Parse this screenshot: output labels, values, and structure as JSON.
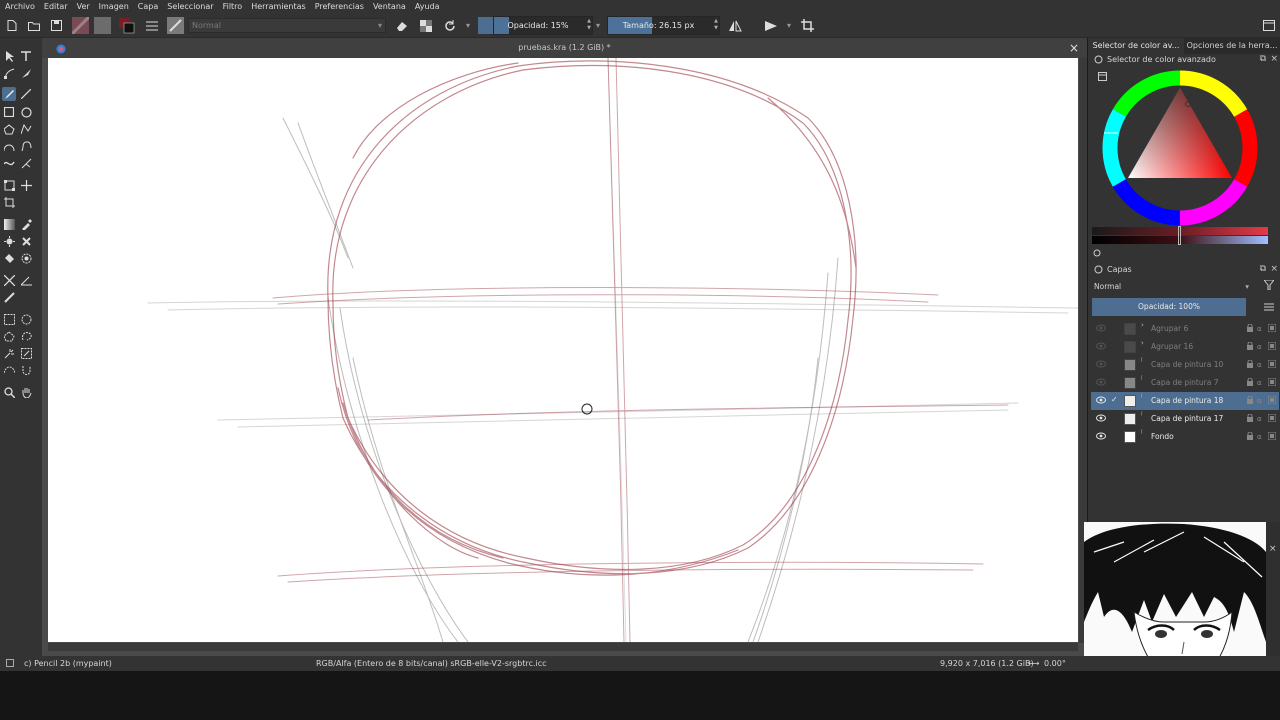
{
  "menu": [
    "Archivo",
    "Editar",
    "Ver",
    "Imagen",
    "Capa",
    "Seleccionar",
    "Filtro",
    "Herramientas",
    "Preferencias",
    "Ventana",
    "Ayuda"
  ],
  "toolbar": {
    "blend_mode": "Normal",
    "opacity_label": "Opacidad: 15%",
    "opacity_fraction": 0.15,
    "size_label": "Tamaño: 26.15 px",
    "size_fraction": 0.4
  },
  "document": {
    "title": "pruebas.kra (1.2 GiB) *",
    "close_glyph": "×"
  },
  "status": {
    "brush": "c) Pencil 2b (mypaint)",
    "color_space": "RGB/Alfa (Entero de 8 bits/canal)  sRGB-elle-V2-srgbtrc.icc",
    "dimensions": "9,920 x 7,016 (1.2 GiB)",
    "rotation": "0.00°"
  },
  "dock": {
    "tab1": "Selector de color av...",
    "tab2": "Opciones de la herra...",
    "color_panel_title": "Selector de color avanzado",
    "layers_title": "Capas",
    "layers_blend": "Normal",
    "layers_opacity": "Opacidad:  100%",
    "layers": [
      {
        "name": "Agrupar 6",
        "visible": false,
        "selected": false,
        "group": true
      },
      {
        "name": "Agrupar 16",
        "visible": false,
        "selected": false,
        "group": true
      },
      {
        "name": "Capa de pintura 10",
        "visible": false,
        "selected": false,
        "group": false
      },
      {
        "name": "Capa de pintura 7",
        "visible": false,
        "selected": false,
        "group": false
      },
      {
        "name": "Capa de pintura 18",
        "visible": true,
        "selected": true,
        "group": false
      },
      {
        "name": "Capa de pintura 17",
        "visible": true,
        "selected": false,
        "group": false
      },
      {
        "name": "Fondo",
        "visible": true,
        "selected": false,
        "group": false
      }
    ]
  },
  "colors": {
    "accent": "#4d6e91",
    "sketch_red": "#9b3a45",
    "sketch_gray": "#666666",
    "panel_bg": "#333333"
  }
}
